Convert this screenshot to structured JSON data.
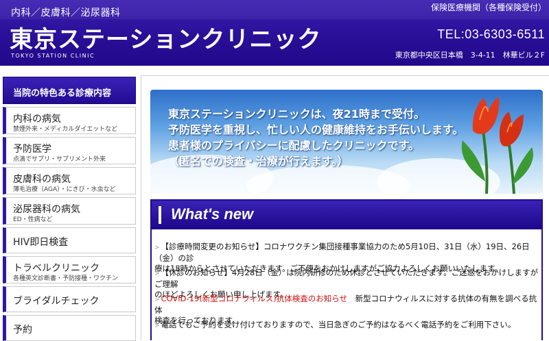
{
  "header": {
    "departments": "内科／皮膚科／泌尿器科",
    "clinic_name": "東京ステーションクリニック",
    "clinic_name_en": "TOKYO STATION CLINIC",
    "insurance": "保険医療機関（各種保険受付）",
    "tel": "TEL:03-6303-6511",
    "address": "東京都中央区日本橋　3-4-11　林華ビル２F"
  },
  "sidebar": {
    "heading": "当院の特色ある診療内容",
    "items": [
      {
        "label": "内科の病気",
        "sub": "禁煙外来・メディカルダイエットなど"
      },
      {
        "label": "予防医学",
        "sub": "点滴でサプリ・サプリメント外来"
      },
      {
        "label": "皮膚科の病気",
        "sub": "薄毛治療（AGA）・にきび・水虫など"
      },
      {
        "label": "泌尿器科の病気",
        "sub": "ED・性病など"
      },
      {
        "label": "HIV即日検査",
        "sub": ""
      },
      {
        "label": "トラベルクリニック",
        "sub": "各種英文診断書・予防接種・ワクチン"
      },
      {
        "label": "ブライダルチェック",
        "sub": ""
      },
      {
        "label": "予約",
        "sub": ""
      }
    ]
  },
  "banner": {
    "lines": [
      "東京ステーションクリニックは、夜21時まで受付。",
      "予防医学を重視し、忙しい人の健康維持をお手伝いします。",
      "患者様のプライバシーに配慮したクリニックです。",
      "（匿名での検査・治療が行えます。）"
    ]
  },
  "whatsnew": {
    "title": "What's new",
    "news": [
      {
        "line1": "【診療時間変更のお知らせ】コロナワクチン集団接種事業協力のため5月10日、31日（水）19日、26日（金）の診",
        "line2": "療は18時からとさせていただきます。ご不便をおかけしますがご協力よろしくお願いいたします。"
      },
      {
        "line1": "【休診のお知らせ】4月28日（金）は院内研修のため休診とさせていただきます。ご迷惑をおかけしますがご理解",
        "line2": "のほどよろしくお願い申し上げます。"
      },
      {
        "red": "COVID-19(新型コロナウィルス)抗体検査のお知らせ",
        "line1": "　新型コロナウィルスに対する抗体の有無を調べる抗体",
        "line2": "検査を行っております。"
      },
      {
        "line1": "電話でもご予約を受け付けておりますので、当日急ぎのご予約はなるべく電話予約をご利用下さい。"
      }
    ]
  },
  "colors": {
    "header_bg": "#2a0f98",
    "accent": "#2a1ba0",
    "notice_red": "#d01010"
  }
}
